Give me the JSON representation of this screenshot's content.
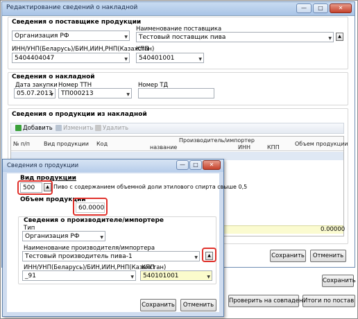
{
  "main": {
    "title": "Редактирование сведений о накладной",
    "supplier": {
      "section_title": "Сведения о поставщике продукции",
      "type_value": "Организация РФ",
      "name_label": "Наименование поставщика",
      "name_value": "Тестовый поставщик пива",
      "inn_label": "ИНН/УНП(Беларусь)/БИН,ИИН,РНП(Казахстан)",
      "inn_value": "5404404047",
      "kpp_label": "КПП",
      "kpp_value": "540401001"
    },
    "invoice": {
      "section_title": "Сведения о накладной",
      "date_label": "Дата закупки",
      "date_value": "05.07.2013",
      "ttn_label": "Номер ТТН",
      "ttn_value": "ТП000213",
      "td_label": "Номер ТД",
      "td_value": ""
    },
    "products": {
      "section_title": "Сведения о продукции из накладной",
      "add_label": "Добавить",
      "edit_label": "Изменить",
      "delete_label": "Удалить",
      "columns": {
        "num": "№ п/п",
        "type": "Вид продукции",
        "code": "Код",
        "producer": "Производитель/импортер",
        "name": "название",
        "inn": "ИНН",
        "kpp": "КПП",
        "volume": "Объем продукции"
      },
      "total_value": "0.00000"
    },
    "save_label": "Сохранить",
    "cancel_label": "Отменить"
  },
  "outer": {
    "save_label": "Сохранить",
    "check_label": "Проверить на совпадения",
    "totals_label": "Итоги по поставщик"
  },
  "dialog": {
    "title": "Сведения о продукции",
    "type_label": "Вид продукции",
    "code_value": "500",
    "type_desc": "Пиво с содержанием объемной доли этилового спирта свыше 0,5",
    "volume_label": "Объем продукции",
    "volume_value": "60.00000",
    "producer": {
      "section_title": "Сведения о производителе/импортере",
      "type_label": "Тип",
      "type_value": "Организация РФ",
      "name_label": "Наименование производителя/импортера",
      "name_value": "Тестовый производитель пива-1",
      "inn_label": "ИНН/УНП(Беларусь)/БИН,ИИН,РНП(Казахстан)",
      "inn_value": "_91",
      "kpp_label": "КПП",
      "kpp_value": "540101001"
    },
    "save_label": "Сохранить",
    "cancel_label": "Отменить"
  }
}
